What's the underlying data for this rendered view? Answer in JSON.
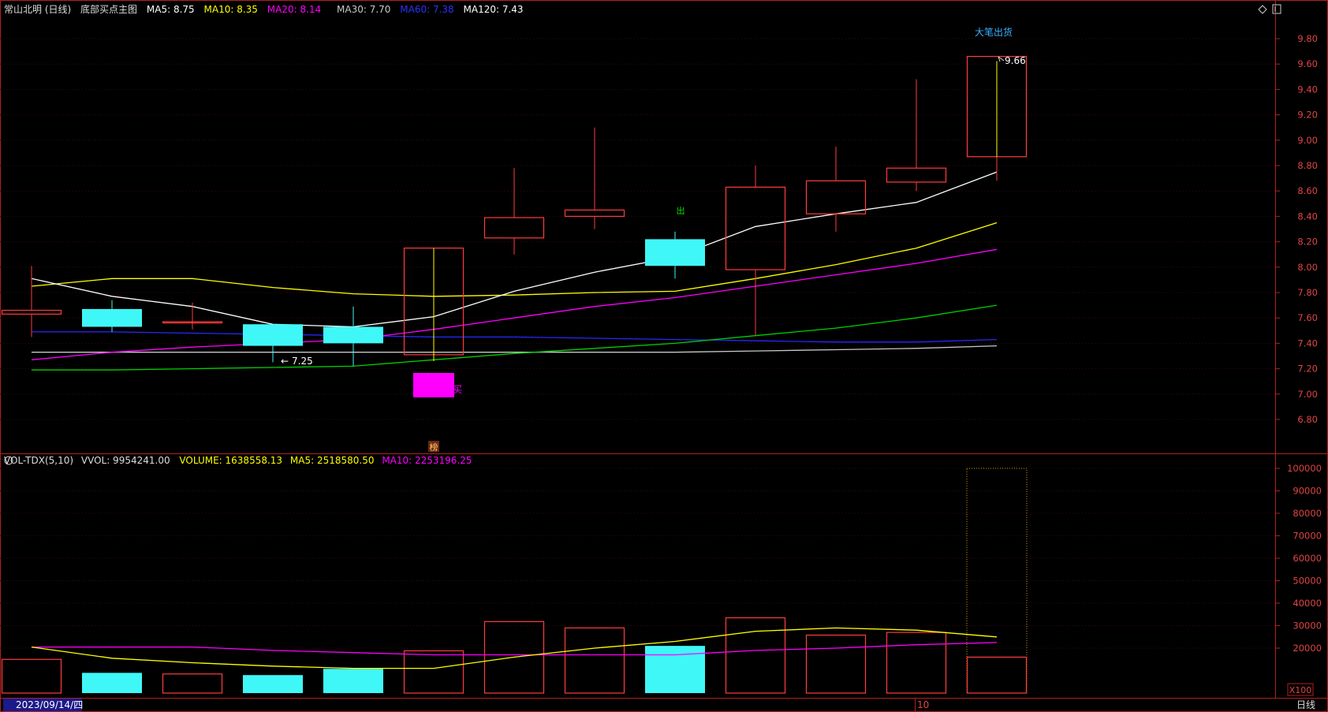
{
  "header": {
    "stock": "常山北明",
    "period": "(日线)",
    "indicator": "底部买点主图",
    "ma": [
      {
        "label": "MA5: 8.75",
        "color": "#ffffff"
      },
      {
        "label": "MA10: 8.35",
        "color": "#ffff00"
      },
      {
        "label": "MA20: 8.14",
        "color": "#ff00ff"
      },
      {
        "label": "MA30: 7.70",
        "color": "#c8c8c8"
      },
      {
        "label": "MA60: 7.38",
        "color": "#3030ff"
      },
      {
        "label": "MA120: 7.43",
        "color": "#ffffff"
      }
    ]
  },
  "volume_header": {
    "name": "VOL-TDX(5,10)",
    "vvol": "VVOL: 9954241.00",
    "volume": "VOLUME: 1638558.13",
    "ma5": "MA5: 2518580.50",
    "ma10": "MA10: 2253196.25"
  },
  "annotations": {
    "big_sell": "大笔出货",
    "high_price": "9.66",
    "low_price": "7.25",
    "sell_signal": "出",
    "buy_signal": "买",
    "bang_signal": "榜"
  },
  "bottom_bar": {
    "date": "2023/09/14/四",
    "month_marker": "10",
    "period_button": "日线",
    "unit": "X100"
  },
  "colors": {
    "up": "#ff3c3c",
    "down": "#3ff7f7",
    "ma5": "#ffffff",
    "ma10": "#ffff00",
    "ma20": "#ff00ff",
    "ma30": "#c8c8c8",
    "ma60": "#2828ff",
    "green": "#00d000",
    "axis": "#b02020"
  },
  "chart_data": {
    "type": "candlestick",
    "price_axis": {
      "ticks": [
        "9.80",
        "9.60",
        "9.40",
        "9.20",
        "9.00",
        "8.80",
        "8.60",
        "8.40",
        "8.20",
        "8.00",
        "7.80",
        "7.60",
        "7.40",
        "7.20",
        "7.00",
        "6.80"
      ],
      "range": [
        6.75,
        9.85
      ]
    },
    "volume_axis": {
      "ticks": [
        "100000",
        "90000",
        "80000",
        "70000",
        "60000",
        "50000",
        "40000",
        "30000",
        "20000"
      ],
      "range": [
        0,
        105000
      ],
      "unit": "X100"
    },
    "candles": [
      {
        "open": 7.63,
        "close": 7.66,
        "high": 8.01,
        "low": 7.45,
        "volume": 15000
      },
      {
        "open": 7.67,
        "close": 7.53,
        "high": 7.74,
        "low": 7.49,
        "volume": 9000
      },
      {
        "open": 7.57,
        "close": 7.57,
        "high": 7.72,
        "low": 7.51,
        "volume": 8500
      },
      {
        "open": 7.55,
        "close": 7.38,
        "high": 7.55,
        "low": 7.25,
        "volume": 8000
      },
      {
        "open": 7.53,
        "close": 7.4,
        "high": 7.69,
        "low": 7.22,
        "volume": 10800
      },
      {
        "open": 7.31,
        "close": 8.15,
        "high": 8.15,
        "low": 7.26,
        "volume": 18800
      },
      {
        "open": 8.23,
        "close": 8.39,
        "high": 8.78,
        "low": 8.1,
        "volume": 31800
      },
      {
        "open": 8.4,
        "close": 8.45,
        "high": 9.1,
        "low": 8.3,
        "volume": 29000
      },
      {
        "open": 8.22,
        "close": 8.01,
        "high": 8.28,
        "low": 7.91,
        "volume": 21000
      },
      {
        "open": 7.98,
        "close": 8.63,
        "high": 8.8,
        "low": 7.46,
        "volume": 33500
      },
      {
        "open": 8.42,
        "close": 8.68,
        "high": 8.95,
        "low": 8.28,
        "volume": 25800
      },
      {
        "open": 8.67,
        "close": 8.78,
        "high": 9.48,
        "low": 8.6,
        "volume": 27000
      },
      {
        "open": 8.87,
        "close": 9.66,
        "high": 9.66,
        "low": 8.68,
        "volume": 16000
      }
    ],
    "ma_lines": {
      "ma5": [
        7.91,
        null,
        7.77,
        7.69,
        7.55,
        7.53,
        7.61,
        7.81,
        7.96,
        8.08,
        8.32,
        8.42,
        8.51,
        8.75
      ],
      "ma10": [
        7.85,
        7.91,
        7.91,
        7.84,
        7.79,
        7.77,
        7.78,
        7.8,
        7.81,
        7.91,
        8.02,
        8.15,
        8.35
      ],
      "ma20": [
        7.27,
        7.33,
        7.37,
        7.4,
        7.43,
        7.51,
        7.6,
        7.69,
        7.76,
        7.85,
        7.94,
        8.03,
        8.14
      ],
      "ma60": [
        7.49,
        7.49,
        7.48,
        7.47,
        7.46,
        7.45,
        7.45,
        7.44,
        7.43,
        7.42,
        7.41,
        7.41,
        7.43
      ],
      "ma30": [
        7.33,
        7.33,
        7.33,
        7.33,
        7.33,
        7.33,
        7.33,
        7.33,
        7.33,
        7.34,
        7.35,
        7.36,
        7.38
      ],
      "green": [
        7.19,
        7.19,
        7.2,
        7.21,
        7.22,
        7.27,
        7.32,
        7.36,
        7.4,
        7.46,
        7.52,
        7.6,
        7.7
      ]
    },
    "volume_ma": {
      "ma5": [
        20500,
        15500,
        13500,
        12000,
        11000,
        11000,
        16000,
        20000,
        23000,
        27500,
        29000,
        28000,
        25000
      ],
      "ma10": [
        20500,
        20500,
        20500,
        19000,
        18000,
        17000,
        17000,
        17000,
        17000,
        19000,
        20000,
        21500,
        22500
      ]
    },
    "volume_ghost": 100000
  }
}
